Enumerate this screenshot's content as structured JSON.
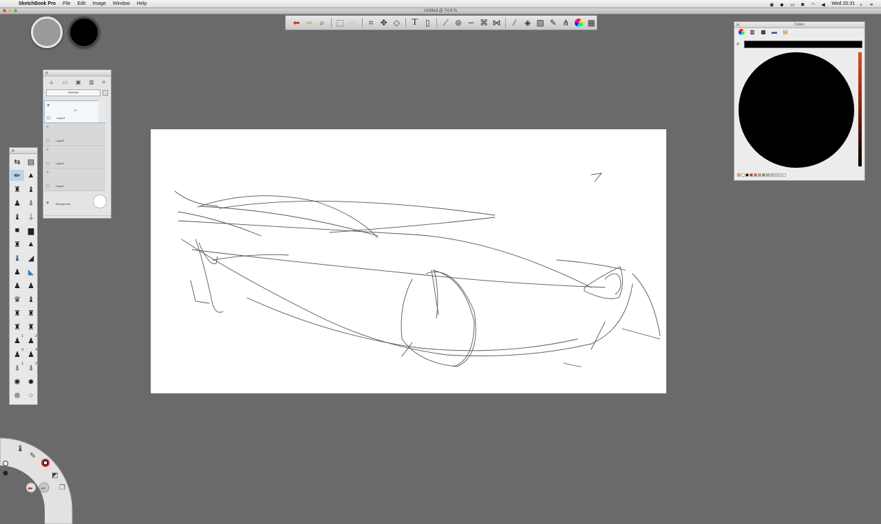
{
  "menubar": {
    "app_name": "SketchBook Pro",
    "menus": [
      "File",
      "Edit",
      "Image",
      "Window",
      "Help"
    ],
    "clock": "Wed 20:31"
  },
  "document": {
    "title": "Untitled @ 74.8 %"
  },
  "swatches": {
    "primary_color": "#9a9a9a",
    "secondary_color": "#000000"
  },
  "toolbar": {
    "buttons": [
      "undo",
      "redo",
      "zoom",
      "select",
      "lasso",
      "crop",
      "transform",
      "perspective",
      "text",
      "import",
      "ruler",
      "ellipse",
      "french-curve",
      "perspective-grid",
      "symmetry",
      "stroke",
      "shape",
      "fill",
      "pencil",
      "brush-properties",
      "color-wheel",
      "layer-editor"
    ]
  },
  "layers": {
    "blend_mode": "Normal",
    "items": [
      {
        "name": "Layer4",
        "active": true
      },
      {
        "name": "Layer3",
        "active": false
      },
      {
        "name": "Layer2",
        "active": false
      },
      {
        "name": "Layer1",
        "active": false
      },
      {
        "name": "Background",
        "active": false
      }
    ]
  },
  "colors_panel": {
    "title": "Colors",
    "current_color": "#000000",
    "swatch_colors": [
      "#f0a040",
      "#ffffff",
      "#000000",
      "#d03020",
      "#e06030",
      "#f09040",
      "#808080",
      "#a0a0a0",
      "#c0c0c0",
      "#d0d0d0",
      "#e0e0e0",
      "#f0f0f0"
    ]
  },
  "brush_numbers": [
    "1",
    "2",
    "3",
    "4",
    "1",
    "2"
  ]
}
